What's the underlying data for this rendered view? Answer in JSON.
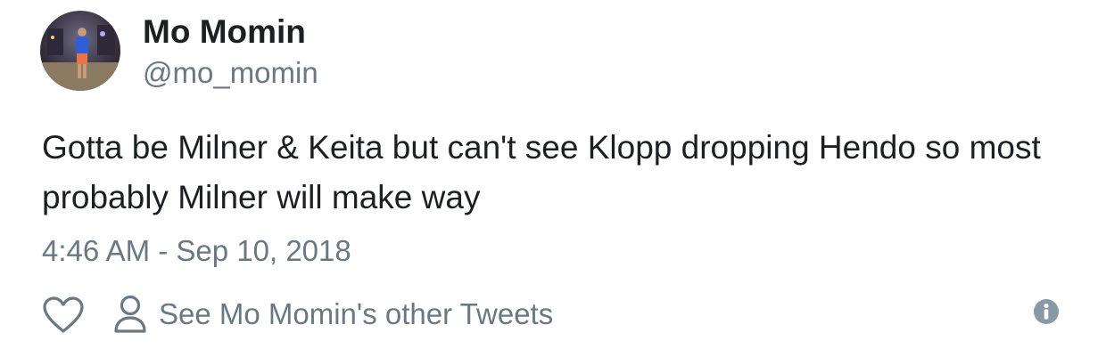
{
  "author": {
    "name": "Mo Momin",
    "handle": "@mo_momin"
  },
  "tweet": {
    "text": "Gotta be Milner & Keita but can't see Klopp dropping Hendo so most probably Milner will make way",
    "timestamp": "4:46 AM - Sep 10, 2018"
  },
  "actions": {
    "see_more_label": "See Mo Momin's other Tweets"
  },
  "icons": {
    "like": "heart-icon",
    "profile": "person-icon",
    "info": "info-icon"
  },
  "colors": {
    "text": "#1c2022",
    "secondary": "#697882"
  }
}
